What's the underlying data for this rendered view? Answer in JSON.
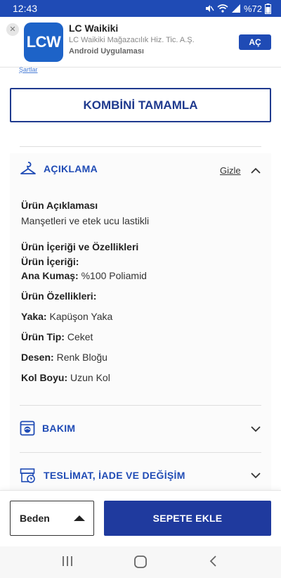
{
  "status_bar": {
    "time": "12:43",
    "battery": "%72",
    "icons": [
      "mute-icon",
      "wifi-icon",
      "signal-icon",
      "battery-icon"
    ]
  },
  "app_banner": {
    "logo_text": "LCW",
    "name": "LC Waikiki",
    "company": "LC Waikiki Mağazacılık Hiz. Tic. A.Ş.",
    "type": "Android Uygulaması",
    "open_label": "AÇ",
    "close_icon": "close-icon"
  },
  "faded_link": "Şartlar",
  "combine_button": "KOMBİNİ TAMAMLA",
  "description_section": {
    "title": "AÇIKLAMA",
    "icon": "hanger-icon",
    "toggle_label": "Gizle",
    "product_description_heading": "Ürün Açıklaması",
    "product_description": "Manşetleri ve etek ucu lastikli",
    "content_features_heading": "Ürün İçeriği ve Özellikleri",
    "content_heading": "Ürün İçeriği:",
    "material_key": "Ana Kumaş:",
    "material_value": "%100 Poliamid",
    "features_heading": "Ürün Özellikleri:",
    "attributes": [
      {
        "key": "Yaka:",
        "value": "Kapüşon Yaka"
      },
      {
        "key": "Ürün Tip:",
        "value": "Ceket"
      },
      {
        "key": "Desen:",
        "value": "Renk Bloğu"
      },
      {
        "key": "Kol Boyu:",
        "value": "Uzun Kol"
      }
    ]
  },
  "care_section": {
    "title": "BAKIM",
    "icon": "washing-machine-icon"
  },
  "delivery_section": {
    "title": "TESLİMAT, İADE VE DEĞİŞİM",
    "icon": "delivery-icon"
  },
  "bottom_bar": {
    "size_label": "Beden",
    "add_to_cart": "SEPETE EKLE"
  },
  "nav_bar": {
    "items": [
      "recent-apps-icon",
      "home-icon",
      "back-icon"
    ]
  },
  "colors": {
    "accent": "#1f4bb5",
    "button_dark": "#1f3a9e",
    "status_bar": "#1f4bb5"
  }
}
